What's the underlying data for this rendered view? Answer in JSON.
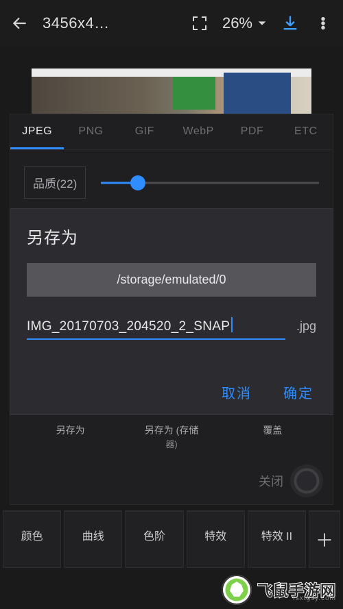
{
  "topbar": {
    "title": "3456x4…",
    "zoom": "26%"
  },
  "panel": {
    "tabs": [
      "JPEG",
      "PNG",
      "GIF",
      "WebP",
      "PDF",
      "ETC"
    ],
    "active_tab": 0,
    "quality_label": "品质(22)",
    "slider_pct": 17,
    "options": {
      "save_as": "另存为",
      "save_storage_line1": "另存为 (存储",
      "save_storage_line2": "器)",
      "overwrite": "覆盖"
    },
    "close": "关闭"
  },
  "dialog": {
    "title": "另存为",
    "path": "/storage/emulated/0",
    "filename": "IMG_20170703_204520_2_SNAP",
    "ext": ".jpg",
    "cancel": "取消",
    "ok": "确定"
  },
  "toolbar": {
    "items": [
      "颜色",
      "曲线",
      "色阶",
      "特效",
      "特效 II"
    ]
  },
  "watermark": {
    "zh": "飞鼠手游网",
    "domain": "fsxtgsy.com"
  }
}
